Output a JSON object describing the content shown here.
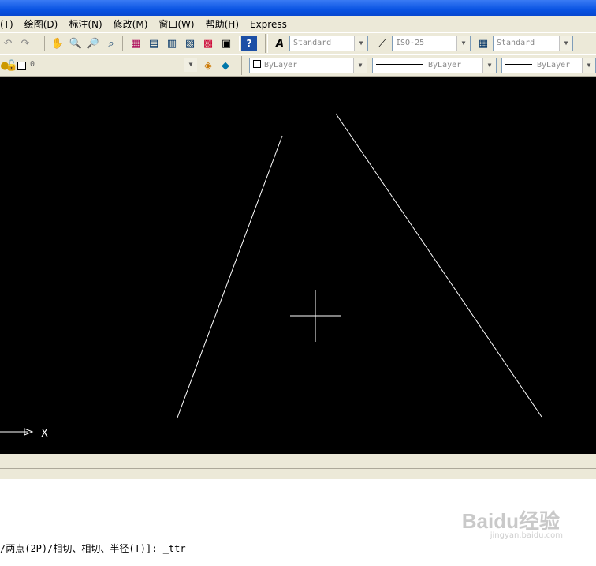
{
  "menu": [
    {
      "id": "tools",
      "label": "(T)"
    },
    {
      "id": "draw",
      "label": "绘图(D)"
    },
    {
      "id": "dimension",
      "label": "标注(N)"
    },
    {
      "id": "modify",
      "label": "修改(M)"
    },
    {
      "id": "window",
      "label": "窗口(W)"
    },
    {
      "id": "help",
      "label": "帮助(H)"
    },
    {
      "id": "express",
      "label": "Express"
    }
  ],
  "toolbar": {
    "text_style": "Standard",
    "dim_style": "ISO-25",
    "table_style": "Standard"
  },
  "layers": {
    "current_layer": "0",
    "color": "ByLayer",
    "linetype": "ByLayer",
    "lineweight": "ByLayer"
  },
  "drawing": {
    "axis_label": "X",
    "background": "#000000",
    "line_color": "#ffffff"
  },
  "command": {
    "prompt": "/两点(2P)/相切、相切、半径(T)]: _ttr"
  },
  "watermark": {
    "brand": "Baidu经验",
    "url": "jingyan.baidu.com"
  }
}
